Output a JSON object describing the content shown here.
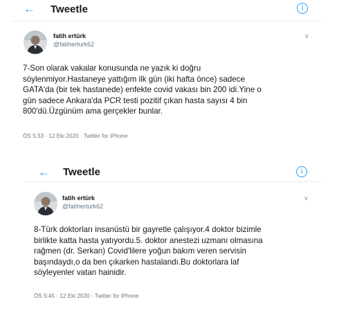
{
  "tweets": [
    {
      "header_title": "Tweetle",
      "author_name": "fatih ertürk",
      "author_handle": "@fatiherturk62",
      "text": "7-Son olarak vakalar konusunda ne yazık ki doğru\nsöylenmiyor.Hastaneye yattığım ilk gün (iki hafta önce) sadece\nGATA'da (bir tek hastanede) enfekte covid vakası bin 200 idi.Yine o\ngün sadece Ankara'da PCR testi pozitif çıkan hasta sayısı 4 bin\n800'dü.Üzgünüm ama gerçekler bunlar.",
      "meta": "ÖS 5:33 · 12 Eki 2020 · Twitter for iPhone"
    },
    {
      "header_title": "Tweetle",
      "author_name": "fatih ertürk",
      "author_handle": "@fatiherturk62",
      "text": "8-Türk doktorları insanüstü bir gayretle çalışıyor.4 doktor bizimle\nbirlikte katta hasta yatıyordu.5. doktor anestezi uzmanı olmasına\nrağmen (dr. Serkan) Covid'lilere yoğun bakım veren servisin\nbaşındaydı,o da ben çıkarken hastalandı.Bu doktorlara laf\nsöyleyenler vatan hainidir.",
      "meta": "ÖS 5:45 · 12 Eki 2020 · Twitter for iPhone"
    }
  ],
  "icons": {
    "back": "arrow-left-icon",
    "info": "info-icon",
    "more": "chevron-down-icon"
  },
  "colors": {
    "accent": "#1da1f2",
    "text": "#14171a",
    "muted": "#657786",
    "divider": "#e6ecf0"
  }
}
